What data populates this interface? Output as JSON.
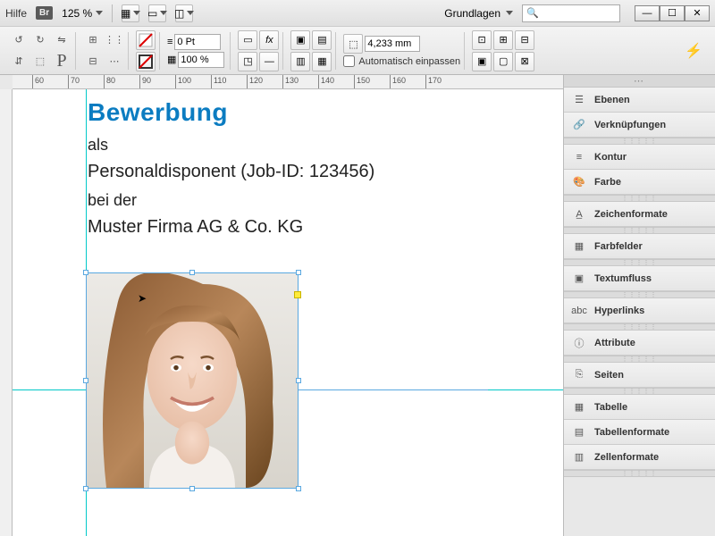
{
  "menubar": {
    "help": "Hilfe",
    "br": "Br",
    "zoom": "125 %",
    "workspace_label": "Grundlagen",
    "search_placeholder": ""
  },
  "toolbar": {
    "stroke_pt": "0 Pt",
    "scale_pct": "100 %",
    "width_mm": "4,233 mm",
    "autofit": "Automatisch einpassen"
  },
  "ruler_ticks": [
    "60",
    "70",
    "80",
    "90",
    "100",
    "110",
    "120",
    "130",
    "140",
    "150",
    "160",
    "170"
  ],
  "document": {
    "title": "Bewerbung",
    "as": "als",
    "position": "Personaldisponent (Job-ID: 123456)",
    "at": "bei der",
    "company": "Muster Firma AG & Co. KG"
  },
  "panels": [
    {
      "icon": "layers",
      "label": "Ebenen"
    },
    {
      "icon": "links",
      "label": "Verknüpfungen"
    },
    {
      "icon": "stroke",
      "label": "Kontur"
    },
    {
      "icon": "color",
      "label": "Farbe"
    },
    {
      "icon": "charstyle",
      "label": "Zeichenformate"
    },
    {
      "icon": "swatches",
      "label": "Farbfelder"
    },
    {
      "icon": "textwrap",
      "label": "Textumfluss"
    },
    {
      "icon": "hyperlinks",
      "label": "Hyperlinks"
    },
    {
      "icon": "attributes",
      "label": "Attribute"
    },
    {
      "icon": "pages",
      "label": "Seiten"
    },
    {
      "icon": "table",
      "label": "Tabelle"
    },
    {
      "icon": "tableformat",
      "label": "Tabellenformate"
    },
    {
      "icon": "cellformat",
      "label": "Zellenformate"
    }
  ]
}
